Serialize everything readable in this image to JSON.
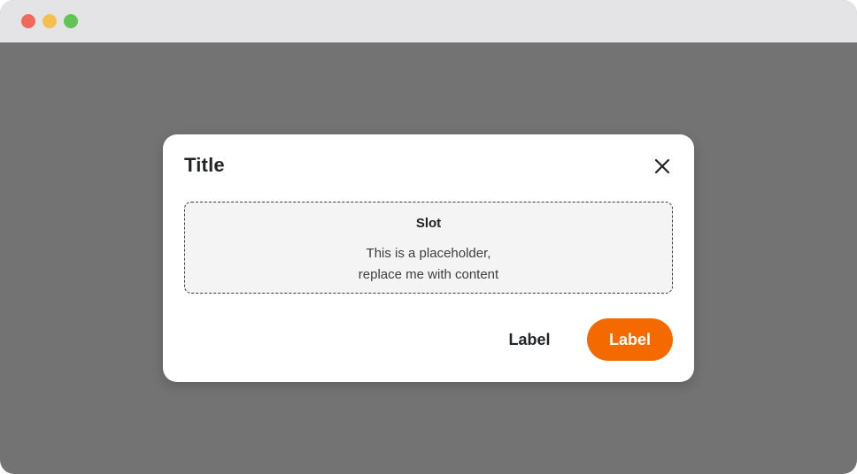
{
  "window": {
    "controls": {
      "close_color": "#ef6a5e",
      "minimize_color": "#f5bf4f",
      "maximize_color": "#61c554"
    }
  },
  "dialog": {
    "title": "Title",
    "close_icon": "close-icon",
    "slot": {
      "title": "Slot",
      "line1": "This is a placeholder,",
      "line2": "replace me with content"
    },
    "secondary_button_label": "Label",
    "primary_button_label": "Label",
    "primary_color": "#f56a00"
  }
}
